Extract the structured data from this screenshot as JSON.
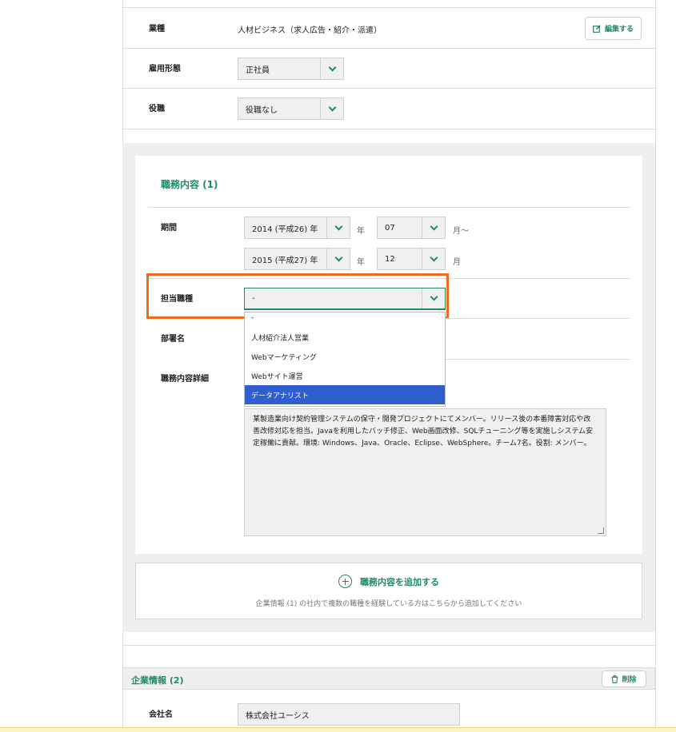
{
  "top_fields": {
    "industry_label": "業種",
    "industry_value": "人材ビジネス（求人広告・紹介・派遣）",
    "edit_label": "編集する",
    "employment_label": "雇用形態",
    "employment_value": "正社員",
    "position_label": "役職",
    "position_value": "役職なし"
  },
  "job_section": {
    "title": "職務内容 (1)",
    "period_label": "期間",
    "start_year": "2014 (平成26) 年",
    "start_year_unit": "年",
    "start_month": "07",
    "start_month_unit": "月〜",
    "end_year": "2015 (平成27) 年",
    "end_year_unit": "年",
    "end_month": "12",
    "end_month_unit": "月",
    "role_label": "担当職種",
    "role_value": "-",
    "dept_label": "部署名",
    "detail_label": "職務内容詳細",
    "detail_text": "某製造業向け契約管理システムの保守・開発プロジェクトにてメンバー。リリース後の本番障害対応や改善改修対応を担当。Javaを利用したバッチ修正、Web画面改修、SQLチューニング等を実施しシステム安定稼働に貢献。環境: Windows、Java、Oracle、Eclipse、WebSphere。チーム7名。役割: メンバー。"
  },
  "role_dropdown": {
    "options": [
      "-",
      "人材紹介法人営業",
      "Webマーケティング",
      "Webサイト運営",
      "データアナリスト"
    ],
    "highlighted": "データアナリスト"
  },
  "add_job": {
    "label": "職務内容を追加する",
    "note": "企業情報 (1) の社内で複数の職種を経験している方はこちらから追加してください"
  },
  "company2": {
    "title": "企業情報 (2)",
    "delete_label": "削除",
    "name_label": "会社名",
    "name_value": "株式会社ユーシス"
  },
  "colors": {
    "accent": "#1f8a63",
    "highlight_border": "#f26a1b",
    "selected_option": "#2f5fce"
  }
}
